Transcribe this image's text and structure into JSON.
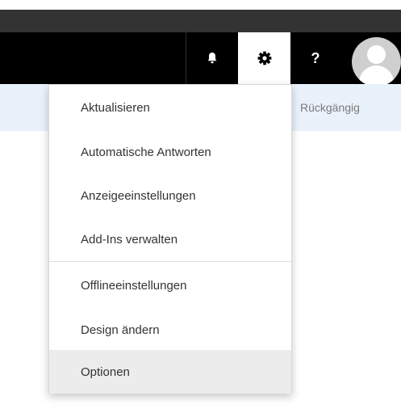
{
  "header": {
    "buttons": [
      {
        "name": "notifications",
        "icon": "bell-icon"
      },
      {
        "name": "settings",
        "icon": "gear-icon"
      },
      {
        "name": "help",
        "icon": "question-mark-icon",
        "label": "?"
      },
      {
        "name": "account",
        "icon": "user-avatar-icon"
      }
    ],
    "colors": {
      "suite_bar": "#000000",
      "top_header": "#333333",
      "active_button": "#ffffff"
    }
  },
  "command_bar": {
    "undo_label": "Rückgängig",
    "background": "#e9f1fb"
  },
  "settings_menu": {
    "items": [
      {
        "label": "Aktualisieren"
      },
      {
        "label": "Automatische Antworten"
      },
      {
        "label": "Anzeigeeinstellungen"
      },
      {
        "label": "Add-Ins verwalten"
      },
      {
        "label": "Offlineeinstellungen"
      },
      {
        "label": "Design ändern"
      },
      {
        "label": "Optionen",
        "selected": true
      }
    ]
  }
}
